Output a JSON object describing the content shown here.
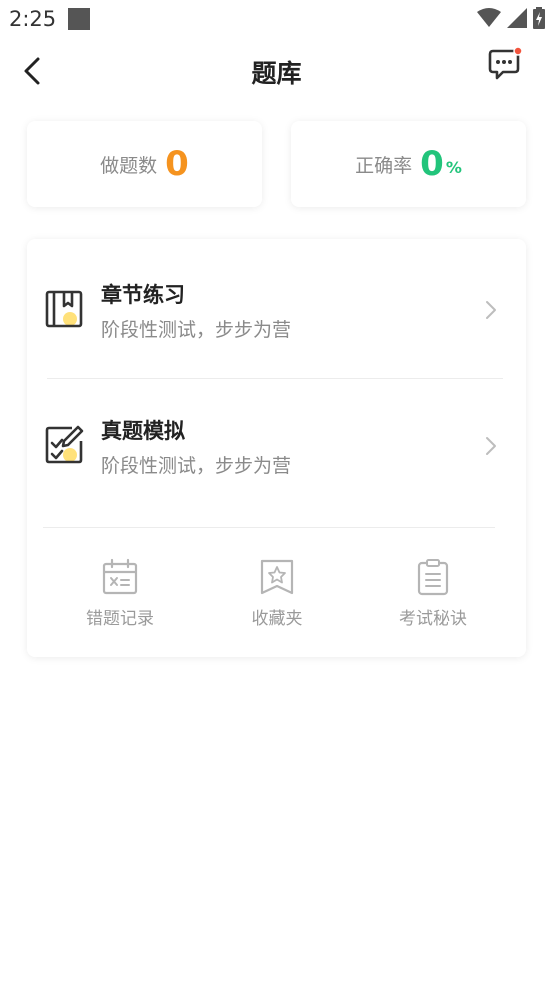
{
  "status_bar": {
    "time": "2:25",
    "icons": [
      "notification-square-icon",
      "wifi-icon",
      "signal-icon",
      "battery-icon"
    ]
  },
  "header": {
    "title": "题库",
    "back_icon": "chevron-left-icon",
    "message_icon": "chat-bubble-icon",
    "badge_color": "#f2543d"
  },
  "stats": {
    "done": {
      "label": "做题数",
      "value": "0",
      "color": "#f5931f"
    },
    "accuracy": {
      "label": "正确率",
      "value": "0",
      "unit": "%",
      "color": "#22c47b"
    }
  },
  "practice": [
    {
      "title": "章节练习",
      "subtitle": "阶段性测试，步步为营",
      "icon": "book-icon"
    },
    {
      "title": "真题模拟",
      "subtitle": "阶段性测试，步步为营",
      "icon": "edit-checklist-icon"
    }
  ],
  "tools": [
    {
      "label": "错题记录",
      "icon": "calendar-x-icon"
    },
    {
      "label": "收藏夹",
      "icon": "star-bookmark-icon"
    },
    {
      "label": "考试秘诀",
      "icon": "clipboard-icon"
    }
  ],
  "colors": {
    "accent_yellow": "#ffe17a",
    "icon_stroke": "#333333",
    "tool_icon": "#b5b5b5"
  }
}
